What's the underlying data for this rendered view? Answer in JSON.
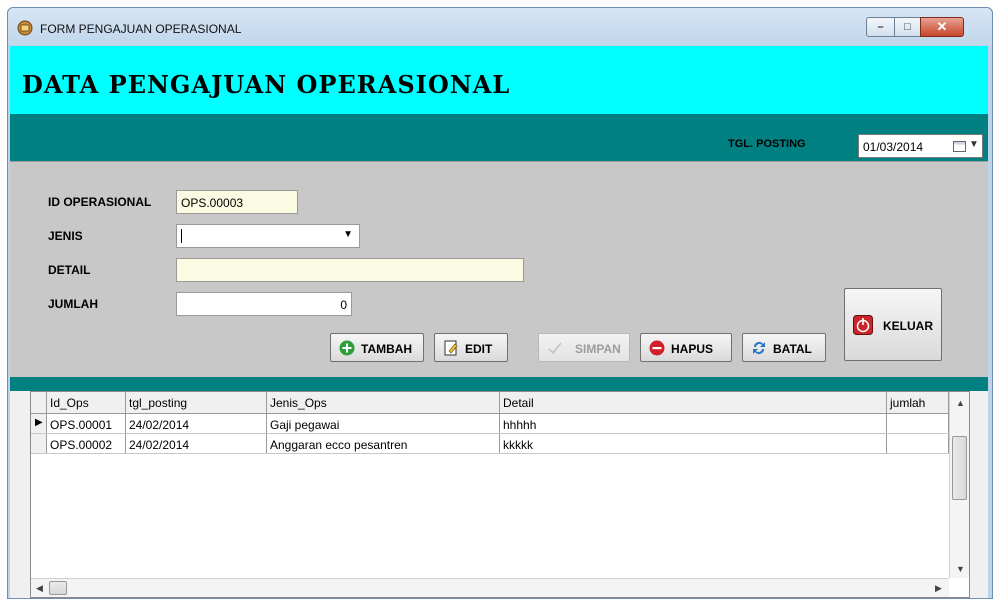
{
  "window": {
    "title": "FORM PENGAJUAN OPERASIONAL",
    "controls": {
      "minimize": "–",
      "maximize": "□",
      "close": "✕"
    }
  },
  "header": {
    "heading": "DATA PENGAJUAN OPERASIONAL"
  },
  "posting": {
    "label": "TGL. POSTING",
    "date": "01/03/2014"
  },
  "form": {
    "id_label": "ID OPERASIONAL",
    "id_value": "OPS.00003",
    "jenis_label": "JENIS",
    "jenis_value": "",
    "detail_label": "DETAIL",
    "detail_value": "",
    "jumlah_label": "JUMLAH",
    "jumlah_value": "0"
  },
  "buttons": {
    "tambah": "TAMBAH",
    "edit": "EDIT",
    "simpan": "SIMPAN",
    "hapus": "HAPUS",
    "batal": "BATAL",
    "keluar": "KELUAR"
  },
  "grid": {
    "columns": [
      "Id_Ops",
      "tgl_posting",
      "Jenis_Ops",
      "Detail",
      "jumlah"
    ],
    "rows": [
      [
        "OPS.00001",
        "24/02/2014",
        "Gaji pegawai",
        "hhhhh",
        ""
      ],
      [
        "OPS.00002",
        "24/02/2014",
        "Anggaran ecco pesantren",
        "kkkkk",
        ""
      ]
    ]
  },
  "colors": {
    "header_band": "#00ffff",
    "teal_band": "#008080",
    "panel": "#c8c8c8",
    "readonly_field": "#fbfbe4"
  }
}
